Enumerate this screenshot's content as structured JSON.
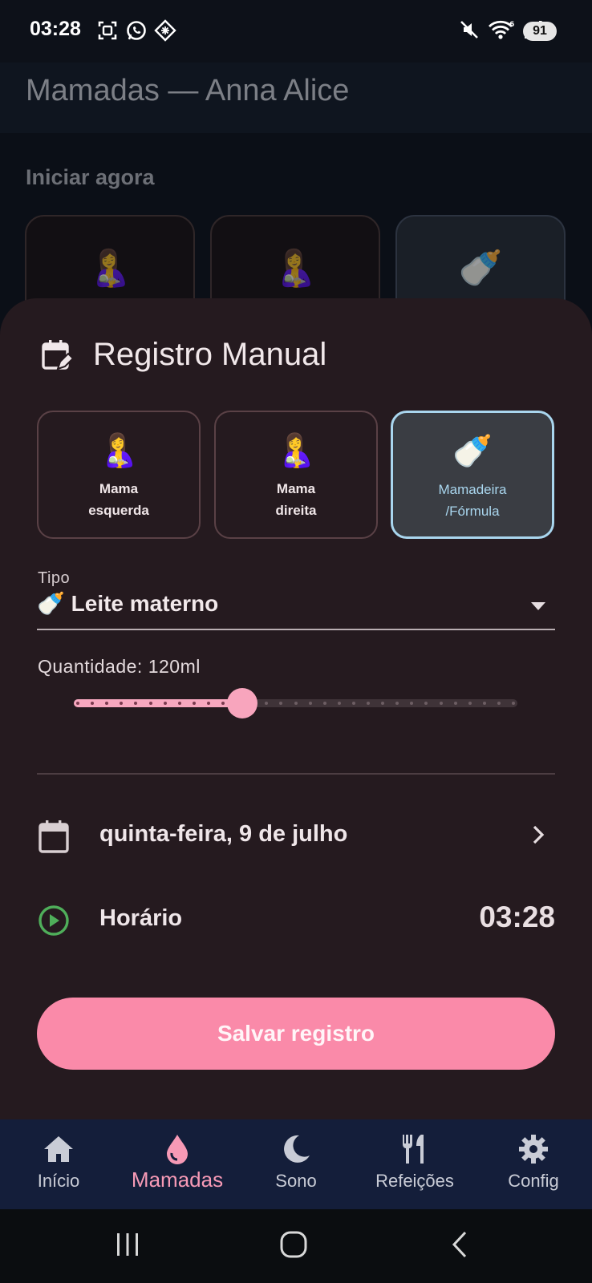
{
  "status_bar": {
    "time": "03:28",
    "battery": "91",
    "left_icons": [
      "screenshot-icon",
      "whatsapp-icon",
      "app-grid-icon"
    ],
    "right_icons": [
      "mute-icon",
      "wifi-icon",
      "signal-icon"
    ]
  },
  "app_bar": {
    "title": "Mamadas — Anna Alice"
  },
  "background": {
    "section_label": "Iniciar agora",
    "cards": [
      {
        "emoji": "🤱",
        "icon": "breastfeeding-icon"
      },
      {
        "emoji": "🤱",
        "icon": "breastfeeding-icon"
      },
      {
        "emoji": "🍼",
        "icon": "baby-bottle-icon"
      }
    ]
  },
  "sheet": {
    "title": "Registro Manual",
    "header_icon": "calendar-edit-icon",
    "types": [
      {
        "emoji": "🤱",
        "label_line1": "Mama",
        "label_line2": "esquerda",
        "selected": false
      },
      {
        "emoji": "🤱",
        "label_line1": "Mama",
        "label_line2": "direita",
        "selected": false
      },
      {
        "emoji": "🍼",
        "label_line1": "Mamadeira",
        "label_line2": "/Fórmula",
        "selected": true
      }
    ],
    "tipo": {
      "label": "Tipo",
      "value": "🍼 Leite materno"
    },
    "quantity": {
      "label": "Quantidade: 120ml",
      "slider_fraction": 0.38,
      "steps": 30
    },
    "date_row": {
      "icon": "calendar-icon",
      "label": "quinta-feira, 9 de julho"
    },
    "time_row": {
      "icon": "play-circle-icon",
      "label": "Horário",
      "value": "03:28"
    },
    "save_label": "Salvar registro"
  },
  "bottom_nav": {
    "items": [
      {
        "label": "Início",
        "icon": "home-icon",
        "active": false
      },
      {
        "label": "Mamadas",
        "icon": "drop-icon",
        "active": true
      },
      {
        "label": "Sono",
        "icon": "moon-icon",
        "active": false
      },
      {
        "label": "Refeições",
        "icon": "fork-knife-icon",
        "active": false
      },
      {
        "label": "Config",
        "icon": "gear-icon",
        "active": false
      }
    ]
  },
  "colors": {
    "accent": "#fa8aa9",
    "selected_border": "#a9d6ee",
    "sheet_bg": "#251a1f",
    "nav_bg": "#141e3a"
  }
}
